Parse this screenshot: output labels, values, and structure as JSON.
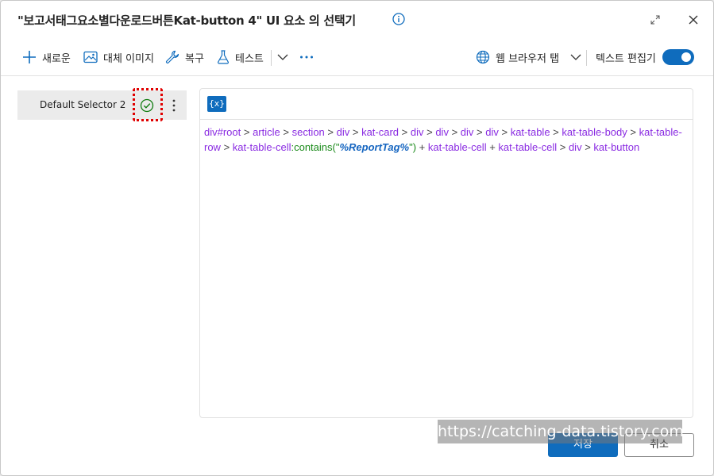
{
  "dialog": {
    "title": "\"보고서태그요소별다운로드버튼Kat-button 4\" UI 요소 의 선택기"
  },
  "toolbar": {
    "new_label": "새로운",
    "replace_image_label": "대체 이미지",
    "repair_label": "복구",
    "test_label": "테스트",
    "browser_tab_label": "웹 브라우저 탭",
    "text_editor_label": "텍스트 편집기",
    "text_editor_enabled": true
  },
  "selectors": [
    {
      "label": "Default Selector 2",
      "status": "valid"
    }
  ],
  "editor": {
    "variable_button_label": "{x}",
    "tokens": [
      {
        "t": "div#root",
        "c": "p"
      },
      {
        "t": " > ",
        "c": "o"
      },
      {
        "t": "article",
        "c": "p"
      },
      {
        "t": " > ",
        "c": "o"
      },
      {
        "t": "section",
        "c": "p"
      },
      {
        "t": " > ",
        "c": "o"
      },
      {
        "t": "div",
        "c": "p"
      },
      {
        "t": " > ",
        "c": "o"
      },
      {
        "t": "kat-card",
        "c": "p"
      },
      {
        "t": " > ",
        "c": "o"
      },
      {
        "t": "div",
        "c": "p"
      },
      {
        "t": " > ",
        "c": "o"
      },
      {
        "t": "div",
        "c": "p"
      },
      {
        "t": " > ",
        "c": "o"
      },
      {
        "t": "div",
        "c": "p"
      },
      {
        "t": " > ",
        "c": "o"
      },
      {
        "t": "div",
        "c": "p"
      },
      {
        "t": " > ",
        "c": "o"
      },
      {
        "t": "kat-table",
        "c": "p"
      },
      {
        "t": " > ",
        "c": "o"
      },
      {
        "t": "kat-table-body",
        "c": "p"
      },
      {
        "t": " > ",
        "c": "o"
      },
      {
        "t": "kat-table-row",
        "c": "p"
      },
      {
        "t": " > ",
        "c": "o"
      },
      {
        "t": "kat-table-cell",
        "c": "p"
      },
      {
        "t": ":contains(\"",
        "c": "f"
      },
      {
        "t": "%ReportTag%",
        "c": "v"
      },
      {
        "t": "\")",
        "c": "f"
      },
      {
        "t": " + ",
        "c": "o"
      },
      {
        "t": "kat-table-cell",
        "c": "p"
      },
      {
        "t": " + ",
        "c": "o"
      },
      {
        "t": "kat-table-cell",
        "c": "p"
      },
      {
        "t": " > ",
        "c": "o"
      },
      {
        "t": "div",
        "c": "p"
      },
      {
        "t": " > ",
        "c": "o"
      },
      {
        "t": "kat-button",
        "c": "p"
      }
    ]
  },
  "footer": {
    "save_label": "저장",
    "cancel_label": "취소"
  },
  "watermark": "https://catching-data.tistory.com",
  "colors": {
    "accent": "#0f6cbd",
    "selector_element": "#8a2be2",
    "function": "#1a8a1a",
    "variable": "#1565c0",
    "highlight_border": "#e00000"
  },
  "icons": [
    "info-icon",
    "expand-icon",
    "close-icon",
    "plus-icon",
    "image-icon",
    "wrench-icon",
    "flask-icon",
    "chevron-down-icon",
    "more-horizontal-icon",
    "globe-icon",
    "check-circle-icon",
    "more-vertical-icon"
  ]
}
